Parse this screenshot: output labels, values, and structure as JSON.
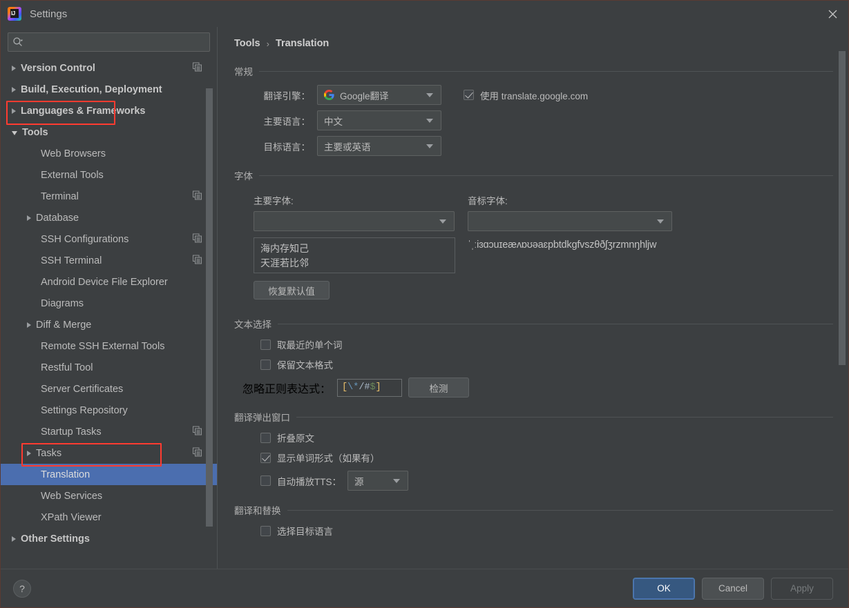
{
  "window": {
    "title": "Settings",
    "app_icon": "intellij-idea-logo",
    "close_icon": "close-icon"
  },
  "sidebar": {
    "search": {
      "placeholder": "",
      "value": "",
      "icon": "search-icon"
    },
    "items": [
      {
        "label": "Version Control",
        "level": 0,
        "arrow": "right",
        "bold": true,
        "copy": true,
        "selected": false
      },
      {
        "label": "Build, Execution, Deployment",
        "level": 0,
        "arrow": "right",
        "bold": true,
        "copy": false,
        "selected": false
      },
      {
        "label": "Languages & Frameworks",
        "level": 0,
        "arrow": "right",
        "bold": true,
        "copy": false,
        "selected": false
      },
      {
        "label": "Tools",
        "level": 0,
        "arrow": "down",
        "bold": true,
        "copy": false,
        "selected": false,
        "highlight": true
      },
      {
        "label": "Web Browsers",
        "level": 1,
        "arrow": "none",
        "bold": false,
        "copy": false,
        "selected": false
      },
      {
        "label": "External Tools",
        "level": 1,
        "arrow": "none",
        "bold": false,
        "copy": false,
        "selected": false
      },
      {
        "label": "Terminal",
        "level": 1,
        "arrow": "none",
        "bold": false,
        "copy": true,
        "selected": false
      },
      {
        "label": "Database",
        "level": 1,
        "arrow": "right",
        "bold": false,
        "copy": false,
        "selected": false
      },
      {
        "label": "SSH Configurations",
        "level": 1,
        "arrow": "none",
        "bold": false,
        "copy": true,
        "selected": false
      },
      {
        "label": "SSH Terminal",
        "level": 1,
        "arrow": "none",
        "bold": false,
        "copy": true,
        "selected": false
      },
      {
        "label": "Android Device File Explorer",
        "level": 1,
        "arrow": "none",
        "bold": false,
        "copy": false,
        "selected": false
      },
      {
        "label": "Diagrams",
        "level": 1,
        "arrow": "none",
        "bold": false,
        "copy": false,
        "selected": false
      },
      {
        "label": "Diff & Merge",
        "level": 1,
        "arrow": "right",
        "bold": false,
        "copy": false,
        "selected": false
      },
      {
        "label": "Remote SSH External Tools",
        "level": 1,
        "arrow": "none",
        "bold": false,
        "copy": false,
        "selected": false
      },
      {
        "label": "Restful Tool",
        "level": 1,
        "arrow": "none",
        "bold": false,
        "copy": false,
        "selected": false
      },
      {
        "label": "Server Certificates",
        "level": 1,
        "arrow": "none",
        "bold": false,
        "copy": false,
        "selected": false
      },
      {
        "label": "Settings Repository",
        "level": 1,
        "arrow": "none",
        "bold": false,
        "copy": false,
        "selected": false
      },
      {
        "label": "Startup Tasks",
        "level": 1,
        "arrow": "none",
        "bold": false,
        "copy": true,
        "selected": false
      },
      {
        "label": "Tasks",
        "level": 1,
        "arrow": "right",
        "bold": false,
        "copy": true,
        "selected": false
      },
      {
        "label": "Translation",
        "level": 1,
        "arrow": "none",
        "bold": false,
        "copy": false,
        "selected": true,
        "highlight": true
      },
      {
        "label": "Web Services",
        "level": 1,
        "arrow": "none",
        "bold": false,
        "copy": false,
        "selected": false
      },
      {
        "label": "XPath Viewer",
        "level": 1,
        "arrow": "none",
        "bold": false,
        "copy": false,
        "selected": false
      },
      {
        "label": "Other Settings",
        "level": 0,
        "arrow": "right",
        "bold": true,
        "copy": false,
        "selected": false
      }
    ]
  },
  "main": {
    "breadcrumb": {
      "parent": "Tools",
      "separator": "›",
      "current": "Translation"
    },
    "general": {
      "title": "常规",
      "engine_label": "翻译引擎：",
      "engine_value": "Google翻译",
      "engine_icon": "google-logo-icon",
      "use_translate_google_label": "使用 translate.google.com",
      "use_translate_google_checked": true,
      "primary_lang_label": "主要语言：",
      "primary_lang_value": "中文",
      "target_lang_label": "目标语言：",
      "target_lang_value": "主要或英语"
    },
    "font": {
      "title": "字体",
      "primary_font_label": "主要字体:",
      "primary_font_value": "",
      "phonetic_font_label": "音标字体:",
      "phonetic_font_value": "",
      "preview_line1": "海内存知己",
      "preview_line2": "天涯若比邻",
      "phonetic_preview": "ˈˌːiɜɑɔuɪeæʌɒʊəaɛpbtdkgfvszθðʃʒrzmnŋhljw",
      "restore_default_label": "恢复默认值"
    },
    "text_selection": {
      "title": "文本选择",
      "nearest_word_label": "取最近的单个词",
      "nearest_word_checked": false,
      "keep_format_label": "保留文本格式",
      "keep_format_checked": false,
      "ignore_regex_label": "忽略正则表达式：",
      "ignore_regex_value": "[\\*/#$]",
      "detect_button_label": "检测"
    },
    "popup": {
      "title": "翻译弹出窗口",
      "fold_source_label": "折叠原文",
      "fold_source_checked": false,
      "show_word_forms_label": "显示单词形式（如果有）",
      "show_word_forms_checked": true,
      "auto_tts_label": "自动播放TTS：",
      "auto_tts_checked": false,
      "auto_tts_value": "源"
    },
    "replace": {
      "title": "翻译和替换",
      "select_target_lang_label": "选择目标语言",
      "select_target_lang_checked": false
    }
  },
  "footer": {
    "help_label": "?",
    "ok_label": "OK",
    "cancel_label": "Cancel",
    "apply_label": "Apply"
  },
  "colors": {
    "accent": "#4b6eaf",
    "highlight_box": "#ff3b30",
    "background": "#3c3f41",
    "text": "#bbbbbb"
  }
}
